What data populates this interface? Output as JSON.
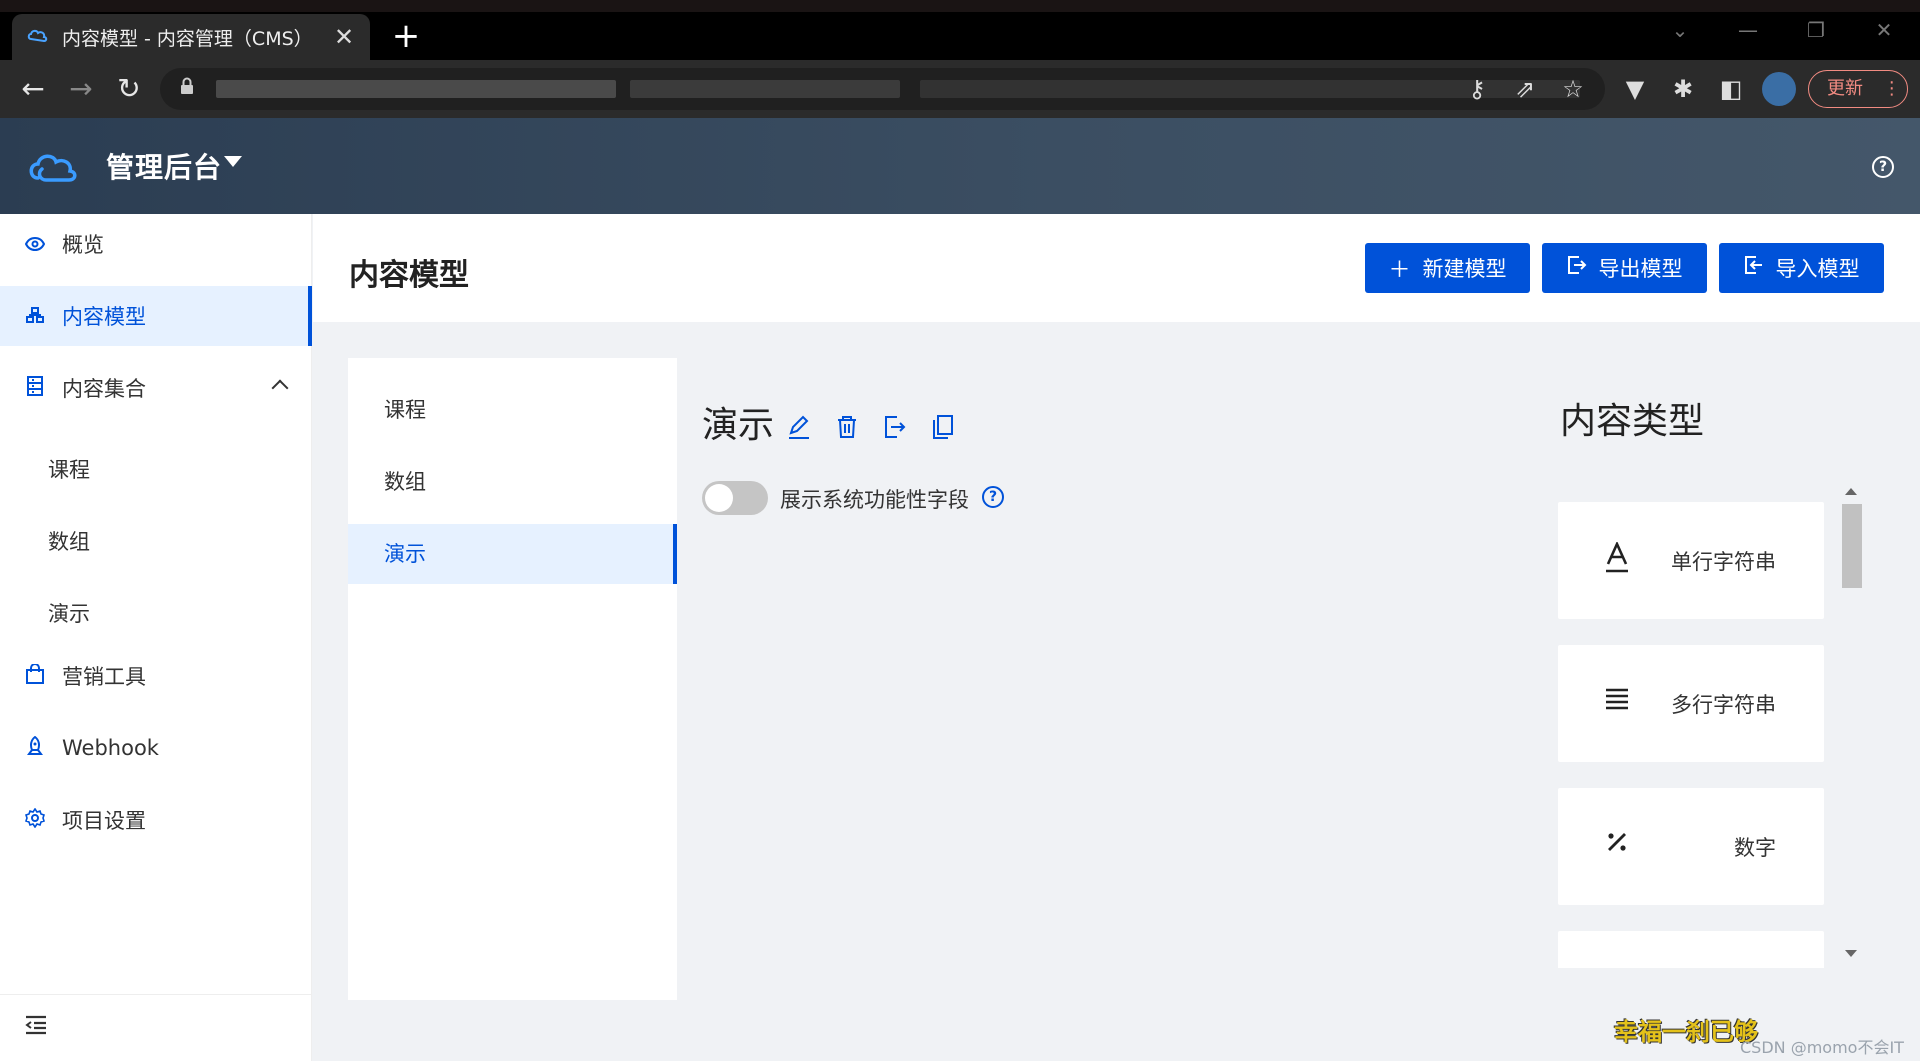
{
  "browser": {
    "tab_title": "内容模型 - 内容管理（CMS）",
    "tab_close": "✕",
    "new_tab": "+",
    "update_label": "更新"
  },
  "app": {
    "title": "管理后台",
    "help": "?"
  },
  "sidebar": {
    "items": [
      {
        "label": "概览",
        "icon": "eye-icon"
      },
      {
        "label": "内容模型",
        "icon": "model-tree-icon",
        "active": true
      },
      {
        "label": "内容集合",
        "icon": "collection-icon",
        "expanded": true
      },
      {
        "label": "营销工具",
        "icon": "bag-icon"
      },
      {
        "label": "Webhook",
        "icon": "rocket-icon"
      },
      {
        "label": "项目设置",
        "icon": "gear-icon"
      }
    ],
    "sub_items": [
      "课程",
      "数组",
      "演示"
    ]
  },
  "page": {
    "title": "内容模型",
    "buttons": {
      "new_model": "新建模型",
      "export_model": "导出模型",
      "import_model": "导入模型"
    }
  },
  "models": {
    "items": [
      "课程",
      "数组",
      "演示"
    ],
    "selected": "演示"
  },
  "detail": {
    "title": "演示",
    "toggle_label": "展示系统功能性字段",
    "toggle_on": false,
    "help": "?"
  },
  "content_types": {
    "title": "内容类型",
    "items": [
      {
        "label": "单行字符串",
        "icon": "text-a-icon"
      },
      {
        "label": "多行字符串",
        "icon": "lines-icon"
      },
      {
        "label": "数字",
        "icon": "percent-icon"
      }
    ]
  },
  "watermark": {
    "overlay_text": "幸福一刹已够",
    "csdn": "CSDN @momo不会IT"
  },
  "colors": {
    "primary": "#0052d9",
    "header_bg": "#2b3d52",
    "active_bg": "#e6f1ff"
  }
}
